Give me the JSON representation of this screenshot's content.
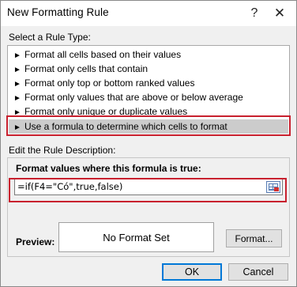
{
  "window": {
    "title": "New Formatting Rule",
    "help_glyph": "?",
    "close_glyph": "✕"
  },
  "rule_type": {
    "label": "Select a Rule Type:",
    "arrow_glyph": "►",
    "items": [
      {
        "label": "Format all cells based on their values"
      },
      {
        "label": "Format only cells that contain"
      },
      {
        "label": "Format only top or bottom ranked values"
      },
      {
        "label": "Format only values that are above or below average"
      },
      {
        "label": "Format only unique or duplicate values"
      },
      {
        "label": "Use a formula to determine which cells to format"
      }
    ],
    "selected_index": 5
  },
  "description": {
    "label": "Edit the Rule Description:",
    "formula_label": "Format values where this formula is true:",
    "formula_value": "=if(F4=\"Có\",true,false)"
  },
  "preview": {
    "label": "Preview:",
    "text": "No Format Set",
    "format_button": "Format..."
  },
  "buttons": {
    "ok": "OK",
    "cancel": "Cancel"
  },
  "colors": {
    "highlight": "#c8202e",
    "selection": "#cccccc",
    "default_button_border": "#0078d7"
  },
  "icons": {
    "collapse": "range-selector-icon"
  }
}
